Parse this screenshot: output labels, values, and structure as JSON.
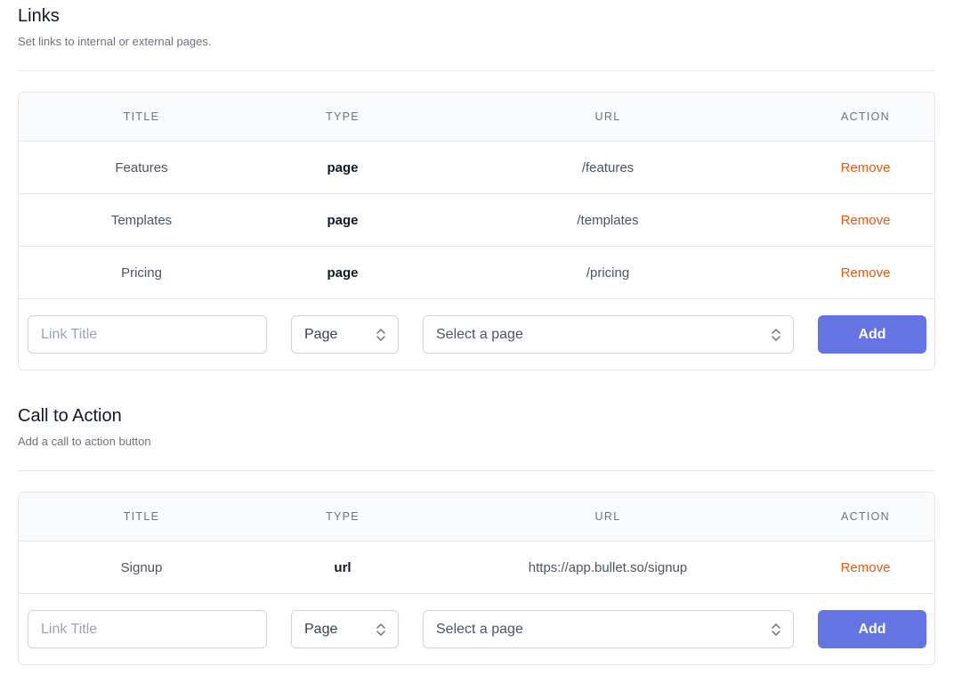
{
  "sections": [
    {
      "title": "Links",
      "description": "Set links to internal or external pages.",
      "table": {
        "headers": [
          "TITLE",
          "TYPE",
          "URL",
          "ACTION"
        ],
        "rows": [
          {
            "title": "Features",
            "type": "page",
            "url": "/features",
            "action": "Remove"
          },
          {
            "title": "Templates",
            "type": "page",
            "url": "/templates",
            "action": "Remove"
          },
          {
            "title": "Pricing",
            "type": "page",
            "url": "/pricing",
            "action": "Remove"
          }
        ]
      },
      "form": {
        "title_placeholder": "Link Title",
        "type_value": "Page",
        "page_placeholder": "Select a page",
        "add_label": "Add"
      }
    },
    {
      "title": "Call to Action",
      "description": "Add a call to action button",
      "table": {
        "headers": [
          "TITLE",
          "TYPE",
          "URL",
          "ACTION"
        ],
        "rows": [
          {
            "title": "Signup",
            "type": "url",
            "url": "https://app.bullet.so/signup",
            "action": "Remove"
          }
        ]
      },
      "form": {
        "title_placeholder": "Link Title",
        "type_value": "Page",
        "page_placeholder": "Select a page",
        "add_label": "Add"
      }
    }
  ],
  "colors": {
    "accent": "#6574e3",
    "remove": "#ea580c",
    "header_bg": "#f9fafb",
    "border": "#e5e7eb"
  },
  "icons": {
    "select_chevron": "chevron-up-down-icon"
  }
}
